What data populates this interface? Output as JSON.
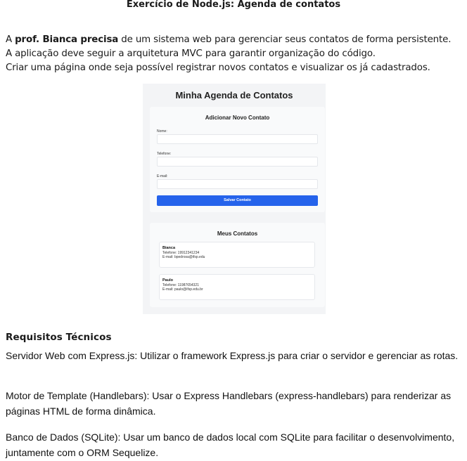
{
  "document": {
    "title": "Exercício de Node.js: Agenda de contatos",
    "intro": {
      "prefix": "A ",
      "bold": "prof. Bianca precisa",
      "line1_rest": " de um sistema web para gerenciar seus contatos de forma persistente.",
      "line2": "A aplicação deve seguir a arquitetura MVC para garantir organização do código.",
      "line3": "Criar uma página onde seja possível registrar novos contatos e visualizar os já cadastrados."
    },
    "requirements_heading": "Requisitos Técnicos",
    "requirements": [
      "Servidor Web com Express.js: Utilizar o framework Express.js para criar o servidor e gerenciar as rotas.",
      "Motor de Template (Handlebars): Usar o Express Handlebars (express-handlebars) para renderizar as páginas HTML de forma dinâmica.",
      "Banco de Dados (SQLite): Usar um banco de dados local com SQLite para facilitar o desenvolvimento, juntamente com o ORM Sequelize."
    ]
  },
  "app": {
    "title": "Minha Agenda de Contatos",
    "form": {
      "title": "Adicionar Novo Contato",
      "name_label": "Nome:",
      "phone_label": "Telefone:",
      "email_label": "E-mail:",
      "save_label": "Salvar Contato"
    },
    "list": {
      "title": "Meus Contatos",
      "contacts": [
        {
          "name": "Bianca",
          "phone": "Telefone: 19912341234",
          "email": "E-mail: bpedrosa@ifsp.edu"
        },
        {
          "name": "Paulo",
          "phone": "Telefone: 11987654321",
          "email": "E-mail: paulo@ifsp.edu.br"
        }
      ]
    }
  },
  "colors": {
    "button": "#2563eb",
    "app_background": "#f3f4f6"
  }
}
